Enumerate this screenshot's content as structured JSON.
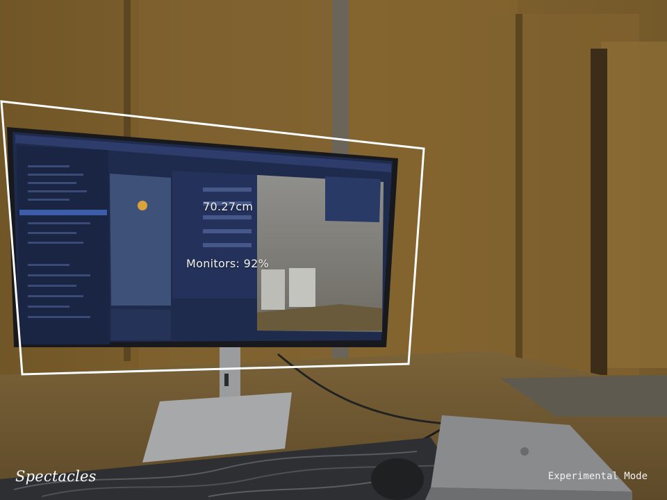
{
  "ar_overlay": {
    "measurement": "70.27cm",
    "detection": "Monitors: 92%"
  },
  "footer": {
    "brand": "Spectacles",
    "mode": "Experimental Mode"
  },
  "colors": {
    "wall": "#7a5d2c",
    "desk": "#6c5631",
    "screen_ui": "#1f2b4d",
    "overlay_outline": "#ffffff"
  }
}
